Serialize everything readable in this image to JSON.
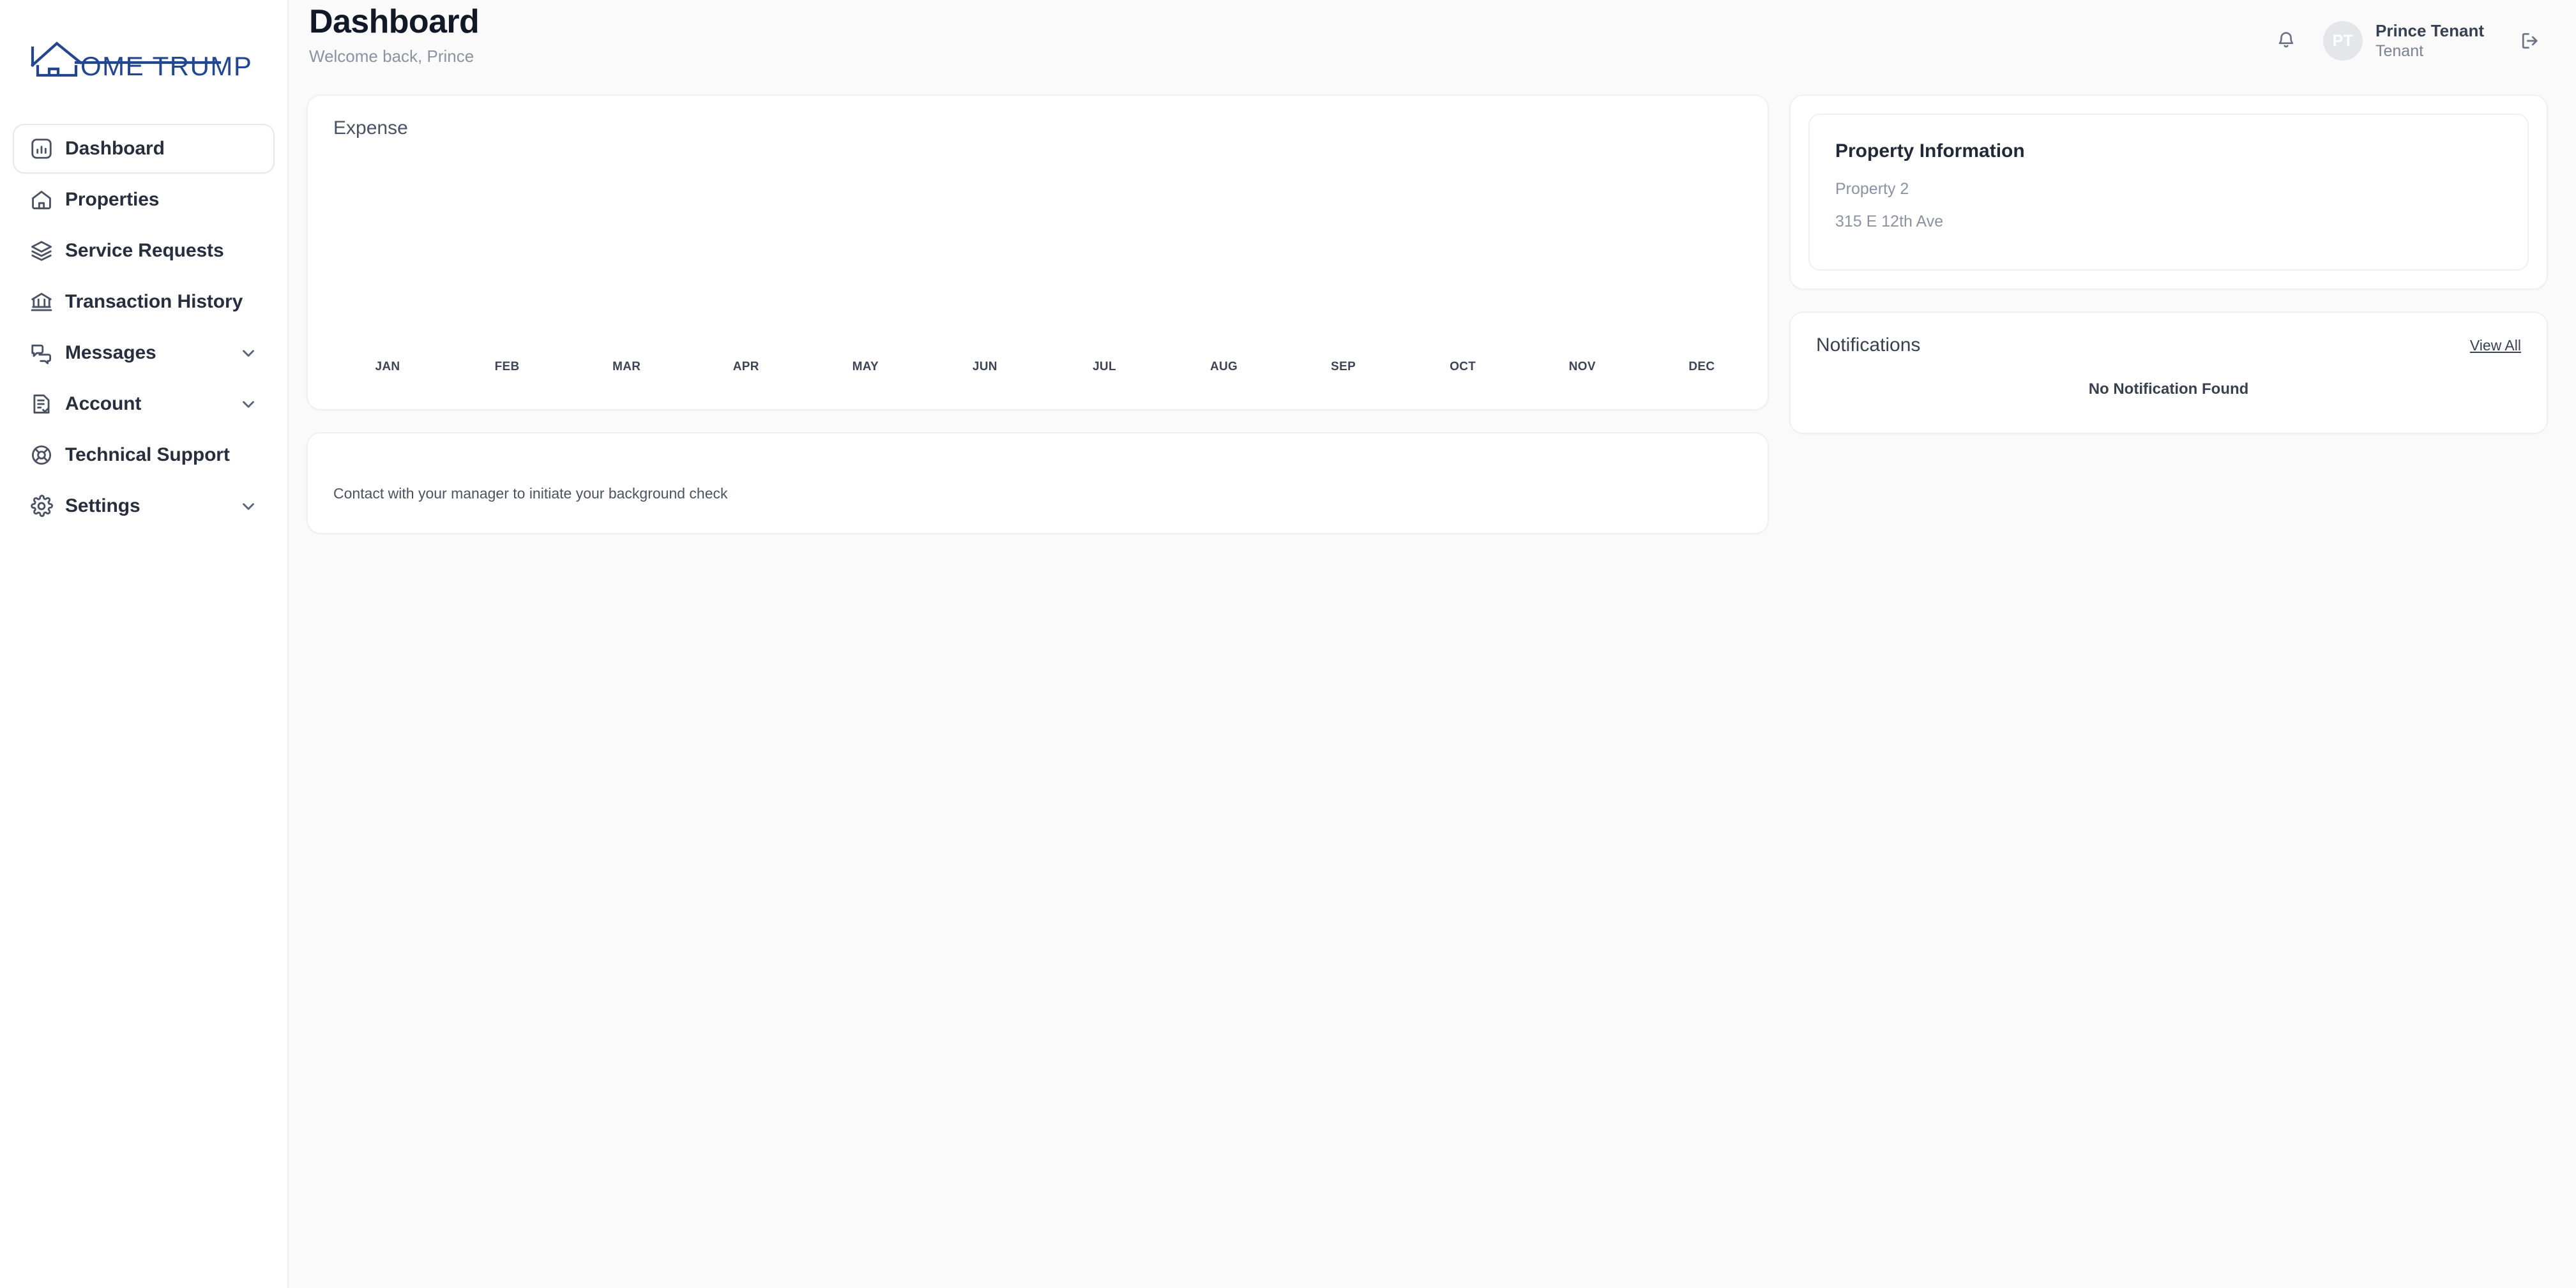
{
  "brand": {
    "logo_text": "OME TRUMPETER",
    "logo_full_name": "HOME TRUMPETER",
    "logo_icon": "house-outline-h-icon",
    "logo_color": "#22478f"
  },
  "sidebar": {
    "items": [
      {
        "label": "Dashboard",
        "icon": "bar-chart-box-icon",
        "active": true,
        "expandable": false
      },
      {
        "label": "Properties",
        "icon": "home-icon",
        "active": false,
        "expandable": false
      },
      {
        "label": "Service Requests",
        "icon": "layers-icon",
        "active": false,
        "expandable": false
      },
      {
        "label": "Transaction History",
        "icon": "bank-icon",
        "active": false,
        "expandable": false
      },
      {
        "label": "Messages",
        "icon": "chat-bubbles-icon",
        "active": false,
        "expandable": true
      },
      {
        "label": "Account",
        "icon": "document-check-icon",
        "active": false,
        "expandable": true
      },
      {
        "label": "Technical Support",
        "icon": "lifebuoy-icon",
        "active": false,
        "expandable": false
      },
      {
        "label": "Settings",
        "icon": "gear-icon",
        "active": false,
        "expandable": true
      }
    ]
  },
  "header": {
    "title": "Dashboard",
    "subtitle": "Welcome back, Prince",
    "notification_icon": "bell-icon",
    "logout_icon": "logout-icon",
    "user": {
      "initials": "PT",
      "name": "Prince Tenant",
      "role": "Tenant"
    }
  },
  "main": {
    "expense": {
      "title": "Expense"
    },
    "background_check": {
      "message": "Contact with your manager to initiate your background check"
    }
  },
  "right_panel": {
    "property": {
      "title": "Property Information",
      "name": "Property 2",
      "address": "315 E 12th Ave"
    },
    "notifications": {
      "title": "Notifications",
      "view_all_label": "View All",
      "empty_message": "No Notification Found"
    }
  },
  "chart_data": {
    "type": "bar",
    "title": "Expense",
    "categories": [
      "JAN",
      "FEB",
      "MAR",
      "APR",
      "MAY",
      "JUN",
      "JUL",
      "AUG",
      "SEP",
      "OCT",
      "NOV",
      "DEC"
    ],
    "values": [
      0,
      0,
      0,
      0,
      0,
      0,
      0,
      0,
      0,
      0,
      0,
      0
    ],
    "xlabel": "",
    "ylabel": "",
    "ylim": [
      0,
      0
    ],
    "grid": false,
    "legend": false,
    "note": "No data plotted; plot area is empty with only month tick labels shown."
  }
}
